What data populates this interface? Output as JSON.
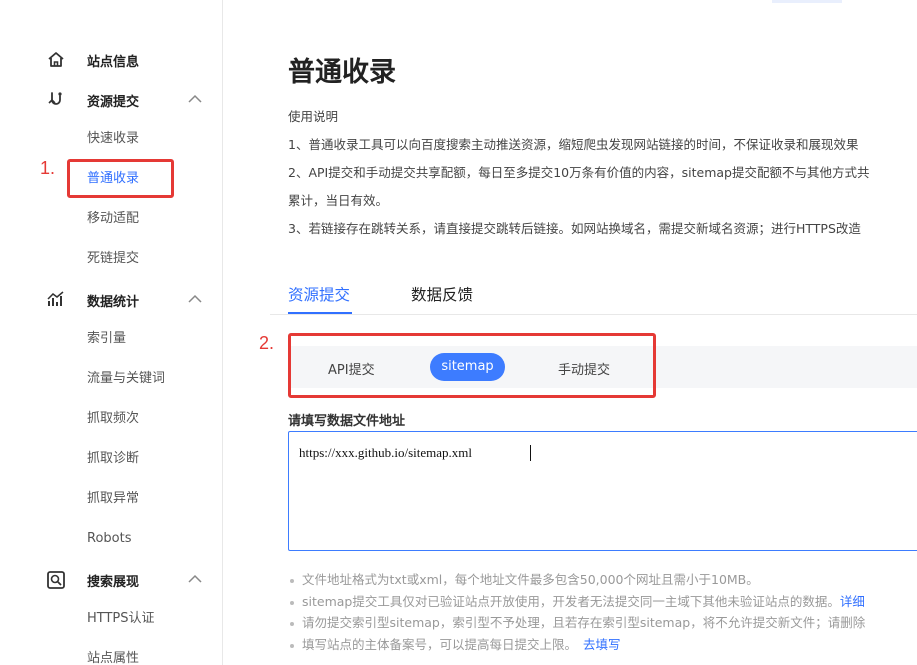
{
  "sidebar": {
    "groups": [
      {
        "label": "站点信息",
        "icon": "home-icon"
      },
      {
        "label": "资源提交",
        "icon": "submit-icon"
      },
      {
        "label": "数据统计",
        "icon": "stats-icon"
      },
      {
        "label": "搜索展现",
        "icon": "search-display-icon"
      }
    ],
    "items": {
      "resource": [
        "快速收录",
        "普通收录",
        "移动适配",
        "死链提交"
      ],
      "stats": [
        "索引量",
        "流量与关键词",
        "抓取频次",
        "抓取诊断",
        "抓取异常",
        "Robots"
      ],
      "display": [
        "HTTPS认证",
        "站点属性"
      ]
    },
    "active_item": "普通收录",
    "annotation_1": "1."
  },
  "main": {
    "title": "普通收录",
    "usage_heading": "使用说明",
    "usage_lines": [
      "1、普通收录工具可以向百度搜索主动推送资源，缩短爬虫发现网站链接的时间，不保证收录和展现效果",
      "2、API提交和手动提交共享配额，每日至多提交10万条有价值的内容，sitemap提交配额不与其他方式共",
      "累计，当日有效。",
      "3、若链接存在跳转关系，请直接提交跳转后链接。如网站换域名，需提交新域名资源；进行HTTPS改造"
    ],
    "tabs": [
      "资源提交",
      "数据反馈"
    ],
    "annotation_2": "2.",
    "subtabs": [
      "API提交",
      "sitemap",
      "手动提交"
    ],
    "field_label": "请填写数据文件地址",
    "url_value": "https://xxx.github.io/sitemap.xml",
    "notes": [
      {
        "text": "文件地址格式为txt或xml，每个地址文件最多包含50,000个网址且需小于10MB。",
        "link": ""
      },
      {
        "text": "sitemap提交工具仅对已验证站点开放使用，开发者无法提交同一主域下其他未验证站点的数据。",
        "link": "详细"
      },
      {
        "text": "请勿提交索引型sitemap，索引型不予处理，且若存在索引型sitemap，将不允许提交新文件；请删除",
        "link": ""
      },
      {
        "text": "填写站点的主体备案号，可以提高每日提交上限。",
        "link": "去填写"
      }
    ]
  },
  "colors": {
    "accent": "#3170ff",
    "annotation": "#e53935"
  }
}
